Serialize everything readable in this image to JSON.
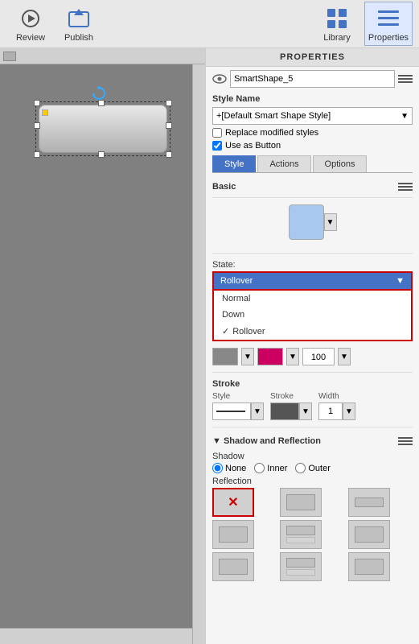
{
  "toolbar": {
    "review_label": "Review",
    "publish_label": "Publish",
    "library_label": "Library",
    "properties_label": "Properties"
  },
  "panel": {
    "header": "PROPERTIES",
    "shape_name": "SmartShape_5",
    "style_section": "Style Name",
    "style_value": "+[Default Smart Shape Style]",
    "replace_styles_label": "Replace modified styles",
    "use_as_button_label": "Use as Button",
    "tabs": [
      "Style",
      "Actions",
      "Options"
    ],
    "active_tab": "Style",
    "basic_label": "Basic",
    "state_label": "State:",
    "state_selected": "Rollover",
    "state_options": [
      "Normal",
      "Down",
      "Rollover"
    ],
    "fill_opacity": "100",
    "stroke_section": "Stroke",
    "stroke_style_label": "Style",
    "stroke_color_label": "Stroke",
    "stroke_width_label": "Width",
    "stroke_width_value": "1",
    "shadow_section": "Shadow and Reflection",
    "shadow_label": "Shadow",
    "shadow_none_label": "None",
    "shadow_inner_label": "Inner",
    "shadow_outer_label": "Outer",
    "reflection_label": "Reflection"
  }
}
